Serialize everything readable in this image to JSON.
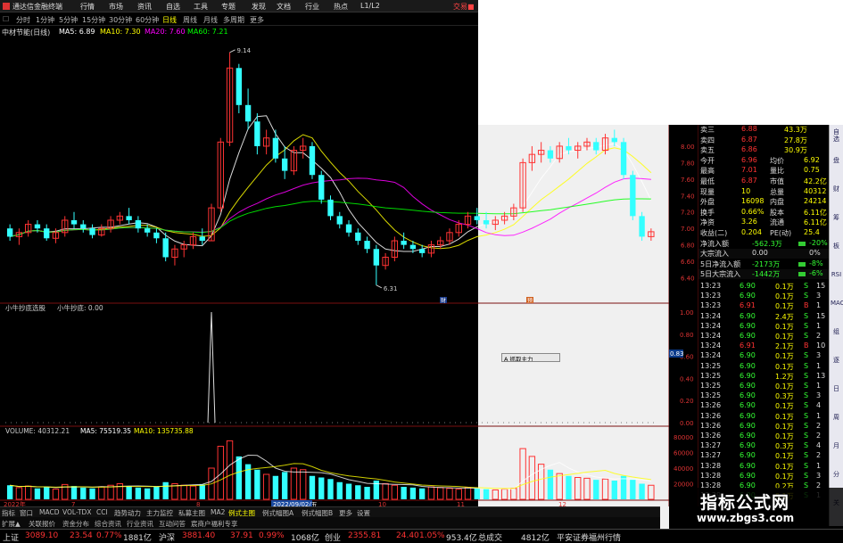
{
  "topbar": {
    "app": "通达信金融终端",
    "menus": [
      "行情",
      "市场",
      "资讯",
      "自选",
      "工具",
      "专题",
      "发现",
      "文档",
      "行业",
      "热点",
      "L1/L2"
    ],
    "trade": "交易■"
  },
  "period": {
    "items": [
      "分时",
      "1分钟",
      "5分钟",
      "15分钟",
      "30分钟",
      "60分钟",
      "日线",
      "周线",
      "月线",
      "多周期",
      "更多"
    ],
    "active": 6
  },
  "ma_legend": {
    "stock": "中材节能(日线)",
    "items": [
      {
        "label": "MA5: 6.89",
        "color": "#ffffff"
      },
      {
        "label": "MA10: 7.30",
        "color": "#ffff00"
      },
      {
        "label": "MA20: 7.60",
        "color": "#ff00ff"
      },
      {
        "label": "MA60: 7.21",
        "color": "#00ff00"
      }
    ]
  },
  "indicator": {
    "title": "小牛抄底选股",
    "sub": "小牛抄底: 0.00",
    "ticks": [
      "1.00",
      "0.80",
      "0.60",
      "0.40",
      "0.20",
      "0.00"
    ],
    "marker": "0.83",
    "float_btn": "A 抓取主力"
  },
  "volume": {
    "title": "VOLUME: 40312.21",
    "ma5": "MA5: 75519.35",
    "ma10": "MA10: 135735.88",
    "ticks": [
      "80000",
      "60000",
      "40000",
      "20000"
    ],
    "date_cursor": "2022/09/02/五",
    "date_left": "2022年",
    "date_m1": "7",
    "date_m2": "8",
    "date_m3": "10",
    "date_m4": "11",
    "date_m5": "12"
  },
  "price_axis": [
    "8.00",
    "7.80",
    "7.60",
    "7.40",
    "7.20",
    "7.00",
    "6.80",
    "6.60",
    "6.40"
  ],
  "annotations": {
    "high": "9.14",
    "low": "6.31",
    "mark_a": "财",
    "mark_b": "预"
  },
  "chart_data": {
    "type": "candlestick",
    "ohlc": [
      [
        7.0,
        7.05,
        6.85,
        6.9
      ],
      [
        6.9,
        7.0,
        6.8,
        6.95
      ],
      [
        6.95,
        7.1,
        6.9,
        7.05
      ],
      [
        7.05,
        7.1,
        6.95,
        7.0
      ],
      [
        7.0,
        7.05,
        6.85,
        6.88
      ],
      [
        6.88,
        7.0,
        6.82,
        6.95
      ],
      [
        6.95,
        7.15,
        6.9,
        7.1
      ],
      [
        7.1,
        7.2,
        7.0,
        7.05
      ],
      [
        7.05,
        7.1,
        6.95,
        7.0
      ],
      [
        7.0,
        7.05,
        6.88,
        6.92
      ],
      [
        6.92,
        7.05,
        6.9,
        7.0
      ],
      [
        7.0,
        7.15,
        6.95,
        7.1
      ],
      [
        7.1,
        7.2,
        7.05,
        7.15
      ],
      [
        7.15,
        7.25,
        7.05,
        7.1
      ],
      [
        7.1,
        7.15,
        6.95,
        7.0
      ],
      [
        7.0,
        7.05,
        6.9,
        6.95
      ],
      [
        6.95,
        7.0,
        6.82,
        6.88
      ],
      [
        6.88,
        6.95,
        6.6,
        6.65
      ],
      [
        6.65,
        6.8,
        6.55,
        6.75
      ],
      [
        6.75,
        6.85,
        6.65,
        6.8
      ],
      [
        6.8,
        6.95,
        6.75,
        6.9
      ],
      [
        6.9,
        7.0,
        6.8,
        6.85
      ],
      [
        6.85,
        7.3,
        6.85,
        7.25
      ],
      [
        7.25,
        8.1,
        7.2,
        8.05
      ],
      [
        8.05,
        9.14,
        8.0,
        8.95
      ],
      [
        8.95,
        9.0,
        8.4,
        8.5
      ],
      [
        8.5,
        8.7,
        8.2,
        8.3
      ],
      [
        8.3,
        8.4,
        7.9,
        8.0
      ],
      [
        8.0,
        8.2,
        7.9,
        8.1
      ],
      [
        8.1,
        8.2,
        7.8,
        7.85
      ],
      [
        7.85,
        8.0,
        7.6,
        7.7
      ],
      [
        7.7,
        8.0,
        7.65,
        7.95
      ],
      [
        7.95,
        8.1,
        7.85,
        8.0
      ],
      [
        8.0,
        8.05,
        7.6,
        7.65
      ],
      [
        7.65,
        7.7,
        7.3,
        7.35
      ],
      [
        7.35,
        7.4,
        7.1,
        7.15
      ],
      [
        7.15,
        7.2,
        7.0,
        7.05
      ],
      [
        7.05,
        7.1,
        6.9,
        6.95
      ],
      [
        6.95,
        7.0,
        6.8,
        6.85
      ],
      [
        6.85,
        6.9,
        6.7,
        6.75
      ],
      [
        6.75,
        6.8,
        6.31,
        6.55
      ],
      [
        6.55,
        6.7,
        6.5,
        6.65
      ],
      [
        6.65,
        6.9,
        6.6,
        6.85
      ],
      [
        6.85,
        6.95,
        6.75,
        6.8
      ],
      [
        6.8,
        6.85,
        6.7,
        6.75
      ],
      [
        6.75,
        6.8,
        6.65,
        6.7
      ],
      [
        6.7,
        6.85,
        6.65,
        6.8
      ],
      [
        6.8,
        6.9,
        6.75,
        6.85
      ],
      [
        6.85,
        7.0,
        6.8,
        6.95
      ],
      [
        6.95,
        7.1,
        6.9,
        7.05
      ],
      [
        7.05,
        7.2,
        7.0,
        7.15
      ],
      [
        7.15,
        7.25,
        7.05,
        7.1
      ],
      [
        7.1,
        7.2,
        7.0,
        7.05
      ],
      [
        7.05,
        7.15,
        6.98,
        7.1
      ],
      [
        7.1,
        7.2,
        7.05,
        7.15
      ],
      [
        7.15,
        7.3,
        7.1,
        7.25
      ],
      [
        7.25,
        7.85,
        7.2,
        7.8
      ],
      [
        7.8,
        8.0,
        7.7,
        7.9
      ],
      [
        7.9,
        8.05,
        7.8,
        7.95
      ],
      [
        7.95,
        8.0,
        7.8,
        7.85
      ],
      [
        7.85,
        8.05,
        7.8,
        8.0
      ],
      [
        8.0,
        8.1,
        7.9,
        7.95
      ],
      [
        7.95,
        8.05,
        7.85,
        8.0
      ],
      [
        8.0,
        8.1,
        7.95,
        8.05
      ],
      [
        8.05,
        8.1,
        7.9,
        7.95
      ],
      [
        7.95,
        8.15,
        7.9,
        8.1
      ],
      [
        8.1,
        8.2,
        8.0,
        8.05
      ],
      [
        8.05,
        8.1,
        7.6,
        7.65
      ],
      [
        7.65,
        7.7,
        7.1,
        7.15
      ],
      [
        7.15,
        7.2,
        6.85,
        6.9
      ],
      [
        6.9,
        7.0,
        6.85,
        6.96
      ]
    ],
    "volume": [
      18000,
      15000,
      17000,
      14000,
      16000,
      13000,
      19000,
      17000,
      15000,
      14000,
      16000,
      18000,
      20000,
      17000,
      15000,
      14000,
      16000,
      22000,
      20000,
      18000,
      17000,
      19000,
      40000,
      68000,
      75000,
      55000,
      45000,
      38000,
      32000,
      30000,
      35000,
      40000,
      38000,
      30000,
      28000,
      26000,
      22000,
      20000,
      18000,
      16000,
      24000,
      20000,
      18000,
      16000,
      15000,
      14000,
      16000,
      15000,
      14000,
      13000,
      15000,
      14000,
      13000,
      12000,
      13000,
      14000,
      65000,
      55000,
      45000,
      38000,
      33000,
      30000,
      28000,
      27000,
      25000,
      26000,
      24000,
      30000,
      25000,
      20000,
      18000
    ],
    "indicator": {
      "spike_index": 22,
      "value": 1.0
    },
    "ylim": [
      6.2,
      9.3
    ]
  },
  "quote": {
    "rows": [
      {
        "l": "卖三",
        "v": "6.88",
        "x": "43.3万"
      },
      {
        "l": "卖四",
        "v": "6.87",
        "x": "27.8万"
      },
      {
        "l": "卖五",
        "v": "6.86",
        "x": "30.9万"
      },
      {
        "l": "今开",
        "v": "6.96",
        "l2": "均价",
        "v2": "6.92"
      },
      {
        "l": "最高",
        "v": "7.01",
        "l2": "量比",
        "v2": "0.75"
      },
      {
        "l": "最低",
        "v": "6.87",
        "l2": "市值",
        "v2": "42.2亿"
      },
      {
        "l": "现量",
        "v": "10",
        "l2": "总量",
        "v2": "40312"
      },
      {
        "l": "外盘",
        "v": "16098",
        "l2": "内盘",
        "v2": "24214"
      },
      {
        "l": "换手",
        "v": "0.66%",
        "l2": "股本",
        "v2": "6.11亿"
      },
      {
        "l": "净资",
        "v": "3.26",
        "l2": "流通",
        "v2": "6.11亿"
      },
      {
        "l": "收益(二)",
        "v": "0.204",
        "l2": "PE(动)",
        "v2": "25.4"
      },
      {
        "l": "净流入额",
        "v": "-562.3万",
        "v2": "-20%"
      },
      {
        "l": "大宗流入",
        "v": "0.00",
        "v2": "0%"
      },
      {
        "l": "5日净流入额",
        "v": "-2173万",
        "v2": "-8%"
      },
      {
        "l": "5日大宗流入",
        "v": "-1442万",
        "v2": "-6%"
      }
    ],
    "ticks": [
      [
        "13:23",
        "6.90",
        "0.1万",
        "S",
        "15"
      ],
      [
        "13:23",
        "6.90",
        "0.1万",
        "S",
        "3"
      ],
      [
        "13:23",
        "6.91",
        "0.1万",
        "B",
        "1"
      ],
      [
        "13:24",
        "6.90",
        "2.4万",
        "S",
        "15"
      ],
      [
        "13:24",
        "6.90",
        "0.1万",
        "S",
        "1"
      ],
      [
        "13:24",
        "6.90",
        "0.1万",
        "S",
        "2"
      ],
      [
        "13:24",
        "6.91",
        "2.1万",
        "B",
        "10"
      ],
      [
        "13:24",
        "6.90",
        "0.1万",
        "S",
        "3"
      ],
      [
        "13:25",
        "6.90",
        "0.1万",
        "S",
        "1"
      ],
      [
        "13:25",
        "6.90",
        "1.2万",
        "S",
        "13"
      ],
      [
        "13:25",
        "6.90",
        "0.1万",
        "S",
        "1"
      ],
      [
        "13:25",
        "6.90",
        "0.3万",
        "S",
        "3"
      ],
      [
        "13:26",
        "6.90",
        "0.1万",
        "S",
        "4"
      ],
      [
        "13:26",
        "6.90",
        "0.1万",
        "S",
        "1"
      ],
      [
        "13:26",
        "6.90",
        "0.1万",
        "S",
        "2"
      ],
      [
        "13:26",
        "6.90",
        "0.1万",
        "S",
        "2"
      ],
      [
        "13:27",
        "6.90",
        "0.3万",
        "S",
        "4"
      ],
      [
        "13:27",
        "6.90",
        "0.1万",
        "S",
        "2"
      ],
      [
        "13:28",
        "6.90",
        "0.1万",
        "S",
        "1"
      ],
      [
        "13:28",
        "6.90",
        "0.1万",
        "S",
        "3"
      ],
      [
        "13:28",
        "6.90",
        "0.2万",
        "S",
        "2"
      ],
      [
        "13:29",
        "6.90",
        "0.1万",
        "S",
        "1"
      ]
    ]
  },
  "side_tabs": [
    "自选",
    "盘",
    "财",
    "筹",
    "板",
    "RSI",
    "MAC",
    "组",
    "逐",
    "日",
    "周",
    "月",
    "分",
    "关"
  ],
  "bottom_tabs": {
    "items": [
      "指标",
      "窗口",
      "MACD",
      "VOL-TDX",
      "CCI",
      "趋势动力",
      "主力监控",
      "私募主图",
      "MA2",
      "例式主图",
      "例式幅图A",
      "例式幅图B",
      "更多",
      "设置"
    ],
    "active": 9
  },
  "nav2": [
    "扩展▲",
    "关联报价",
    "资金分布",
    "综合资讯",
    "行业资讯",
    "互动问答",
    "宸商户福利专享"
  ],
  "statusbar": [
    {
      "t": "上证",
      "c": "#ddd"
    },
    {
      "t": "3089.10",
      "c": "#f33"
    },
    {
      "t": "23.54",
      "c": "#f33"
    },
    {
      "t": "0.77%",
      "c": "#f33"
    },
    {
      "t": "1881亿",
      "c": "#ddd"
    },
    {
      "t": "沪深",
      "c": "#ddd"
    },
    {
      "t": "3881.40",
      "c": "#f33"
    },
    {
      "t": "37.91",
      "c": "#f33"
    },
    {
      "t": "0.99%",
      "c": "#f33"
    },
    {
      "t": "1068亿",
      "c": "#ddd"
    },
    {
      "t": "创业",
      "c": "#ddd"
    },
    {
      "t": "2355.81",
      "c": "#f33"
    },
    {
      "t": "24.40",
      "c": "#f33"
    },
    {
      "t": "1.05%",
      "c": "#f33"
    },
    {
      "t": "953.4亿",
      "c": "#ddd"
    },
    {
      "t": "总成交",
      "c": "#ddd"
    },
    {
      "t": "4812亿",
      "c": "#ddd"
    },
    {
      "t": "平安证券福州行情",
      "c": "#ddd"
    }
  ],
  "watermark": {
    "t1": "指标公式网",
    "t2": "www.zbgs3.com"
  },
  "colors": {
    "up": "#ff3333",
    "down": "#33ffff",
    "ma5": "#ffffff",
    "ma10": "#ffff00",
    "ma20": "#ff00ff",
    "ma60": "#00ff00"
  }
}
